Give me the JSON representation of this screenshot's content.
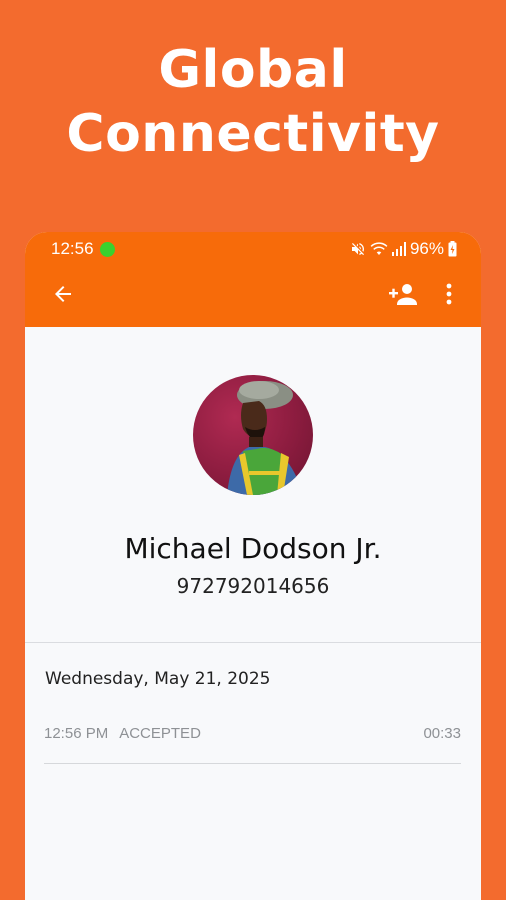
{
  "promo": {
    "title_line1": "Global",
    "title_line2": "Connectivity"
  },
  "status_bar": {
    "time": "12:56",
    "battery": "96%"
  },
  "toolbar": {
    "back_icon": "arrow-left-icon",
    "add_contact_icon": "person-add-icon",
    "more_icon": "more-vert-icon"
  },
  "contact": {
    "name": "Michael Dodson Jr.",
    "phone": "972792014656"
  },
  "call_log": {
    "date": "Wednesday, May 21, 2025",
    "entries": [
      {
        "time": "12:56 PM",
        "status": "ACCEPTED",
        "duration": "00:33"
      }
    ]
  },
  "colors": {
    "background": "#F36B2E",
    "app_bar": "#F76B0A",
    "indicator": "#3AD12E"
  }
}
